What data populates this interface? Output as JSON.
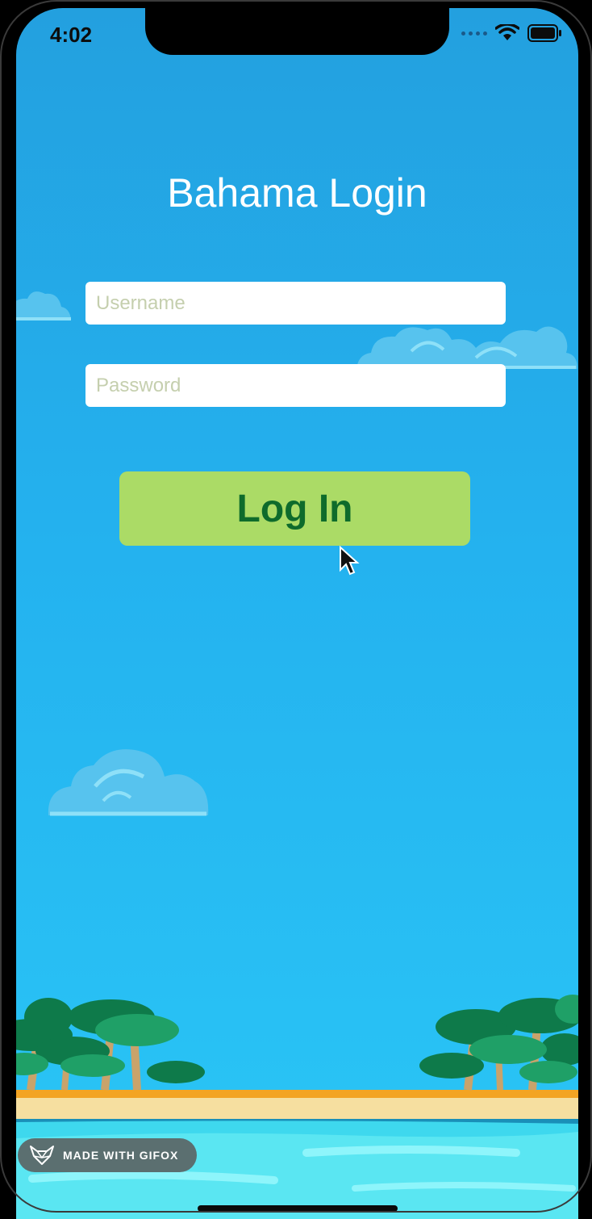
{
  "status_bar": {
    "time": "4:02"
  },
  "app": {
    "title": "Bahama Login",
    "username_placeholder": "Username",
    "password_placeholder": "Password",
    "login_label": "Log In"
  },
  "badge": {
    "label": "MADE WITH GIFOX"
  },
  "colors": {
    "sky_top": "#23a0df",
    "sky_bottom": "#2ac6f6",
    "button_bg": "#abdb66",
    "button_text": "#0e6b2b",
    "sand": "#f6dfa0",
    "water": "#3ed8ee"
  }
}
